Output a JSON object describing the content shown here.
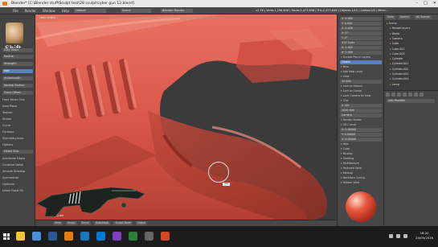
{
  "window": {
    "title": "Blender* [C:\\Blender stuff\\Sculpt test\\28 sculpt\\cyber gun 12.blend]"
  },
  "menubar": {
    "menus": [
      "File",
      "Render",
      "Window",
      "Help"
    ],
    "layout": "Default",
    "scene": "Scene",
    "engine": "Blender Render",
    "stats": "v2.76 | Verts:1,236,826 | Faces:2,473,648 | Tris:2,473,648 | Objects:1/12 | Lamps:0/2 | Mem:..."
  },
  "overlay": {
    "shift_key": "Shift"
  },
  "left_panel": {
    "brush_name": "Clay Strips",
    "rows": [
      {
        "label": "Radius:",
        "value": "90 px"
      },
      {
        "label": "Strength:",
        "value": "0.500"
      },
      {
        "label": "Add",
        "value": "Subtract"
      },
      {
        "label": "Autosmooth:",
        "value": "0.000"
      },
      {
        "label": "Normal Radius:",
        "value": "0.500"
      },
      {
        "label": "Plane Offset:",
        "value": "0.000"
      },
      {
        "label": "Front Faces Only",
        "value": ""
      },
      {
        "label": "Area Plane",
        "value": ""
      },
      {
        "label": "Texture",
        "value": ""
      },
      {
        "label": "Stroke",
        "value": ""
      },
      {
        "label": "Curve",
        "value": ""
      },
      {
        "label": "Dyntopo",
        "value": ""
      },
      {
        "label": "Symmetry/Lock",
        "value": ""
      },
      {
        "label": "Options",
        "value": ""
      },
      {
        "label": "Detail Size:",
        "value": "12.00 px"
      },
      {
        "label": "Subdivide Edges",
        "value": ""
      },
      {
        "label": "Constant Detail",
        "value": ""
      },
      {
        "label": "Smooth Shading",
        "value": ""
      },
      {
        "label": "Symmetrize",
        "value": ""
      },
      {
        "label": "Optimize",
        "value": ""
      },
      {
        "label": "Detail Flood Fill",
        "value": ""
      }
    ]
  },
  "viewport": {
    "header": "User Ortho",
    "object_label": "(1) Cube",
    "bottom_items": [
      "View",
      "Sculpt",
      "Brush",
      "Hide/Mask",
      "Sculpt Mode",
      "Global"
    ],
    "cursor_tip": "Add"
  },
  "properties": {
    "rows": [
      {
        "label": "Location:",
        "value": "X: 0.000"
      },
      {
        "label": "",
        "value": "Y: 0.000"
      },
      {
        "label": "",
        "value": "Z: 0.000"
      },
      {
        "label": "Rotation:",
        "value": "X: 0°"
      },
      {
        "label": "",
        "value": "Y: 0°"
      },
      {
        "label": "Mode:",
        "value": "XYZ Euler"
      },
      {
        "label": "Scale:",
        "value": "X: 1.000"
      },
      {
        "label": "Dimensions:",
        "value": "X: 2.000"
      },
      {
        "label": "Grease Pencil Layers",
        "value": ""
      },
      {
        "label": "Scene",
        "value": "Object"
      },
      {
        "label": "New",
        "value": ""
      },
      {
        "label": "Add New Layer",
        "value": ""
      },
      {
        "label": "View",
        "value": ""
      },
      {
        "label": "Lens:",
        "value": "35.000"
      },
      {
        "label": "Lock to Object:",
        "value": ""
      },
      {
        "label": "Lock to Cursor",
        "value": ""
      },
      {
        "label": "Lock Camera to View",
        "value": ""
      },
      {
        "label": "Clip:",
        "value": ""
      },
      {
        "label": "Start:",
        "value": "0.100"
      },
      {
        "label": "End:",
        "value": "1000.000"
      },
      {
        "label": "Local Camera:",
        "value": "Camera"
      },
      {
        "label": "Render Border",
        "value": ""
      },
      {
        "label": "3D Cursor",
        "value": ""
      },
      {
        "label": "Location:",
        "value": "X: 0.00000"
      },
      {
        "label": "",
        "value": "Y: 0.00000"
      },
      {
        "label": "",
        "value": "Z: 0.00000"
      },
      {
        "label": "Item",
        "value": ""
      },
      {
        "label": "Cube",
        "value": ""
      },
      {
        "label": "Display",
        "value": ""
      },
      {
        "label": "Shading",
        "value": ""
      },
      {
        "label": "Multitexture",
        "value": ""
      },
      {
        "label": "Textured Solid",
        "value": ""
      },
      {
        "label": "Matcap",
        "value": ""
      },
      {
        "label": "Backface Culling",
        "value": ""
      },
      {
        "label": "Hidden Wire",
        "value": ""
      },
      {
        "label": "Ambient Occlusion",
        "value": ""
      }
    ]
  },
  "outliner": {
    "header": [
      "View",
      "Search",
      "All Scenes"
    ],
    "items": [
      "Scene",
      "RenderLayers",
      "World",
      "Camera",
      "Cube",
      "Cube.001",
      "Cube.002",
      "Cylinder",
      "Cylinder.001",
      "Cylinder.002",
      "Cylinder.003",
      "Cylinder.004",
      "Lamp"
    ],
    "lower_label": "Add Modifier"
  },
  "taskbar": {
    "time": "18:20",
    "date": "24/05/2016",
    "app_icons": [
      "file-explorer-icon",
      "chrome-icon",
      "word-icon",
      "blender-icon",
      "photoshop-icon",
      "mail-icon",
      "media-icon",
      "store-icon",
      "settings-icon",
      "powerpoint-icon"
    ],
    "app_colors": [
      "#f2c230",
      "#4a90d9",
      "#2b5797",
      "#e87d0d",
      "#1b75bb",
      "#0078d7",
      "#7f3fbf",
      "#2d7d3a",
      "#666666",
      "#d24726"
    ]
  },
  "colors": {
    "accent": "#5680c2",
    "sculpt": "#d9574a",
    "blender_orange": "#e87d0d"
  }
}
